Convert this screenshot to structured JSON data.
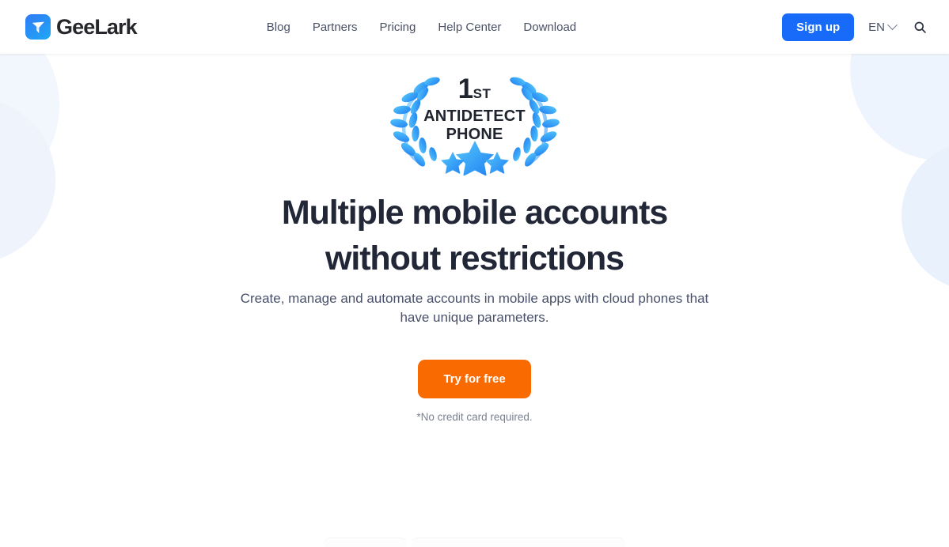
{
  "header": {
    "brand": {
      "name": "GeeLark",
      "logo_icon": "lark-bird-icon",
      "logo_color": "#2f7bf6"
    },
    "nav": [
      {
        "label": "Blog"
      },
      {
        "label": "Partners"
      },
      {
        "label": "Pricing"
      },
      {
        "label": "Help Center"
      },
      {
        "label": "Download"
      }
    ],
    "signup_label": "Sign up",
    "signup_color": "#176bf8",
    "language": {
      "label": "EN",
      "chevron_icon": "chevron-down-icon"
    },
    "search_icon": "search-icon"
  },
  "hero": {
    "badge": {
      "rank": "1",
      "rank_suffix": "ST",
      "line1": "ANTIDETECT",
      "line2": "PHONE",
      "wreath_icon": "laurel-wreath-icon",
      "stars_icon": "three-stars-icon",
      "accent_color": "#29a8f5"
    },
    "title": "Multiple mobile accounts without restrictions",
    "subtitle": "Create, manage and automate accounts in mobile apps with cloud phones that have unique parameters.",
    "cta_label": "Try for free",
    "cta_color": "#f96a00",
    "cta_note": "*No credit card required."
  }
}
